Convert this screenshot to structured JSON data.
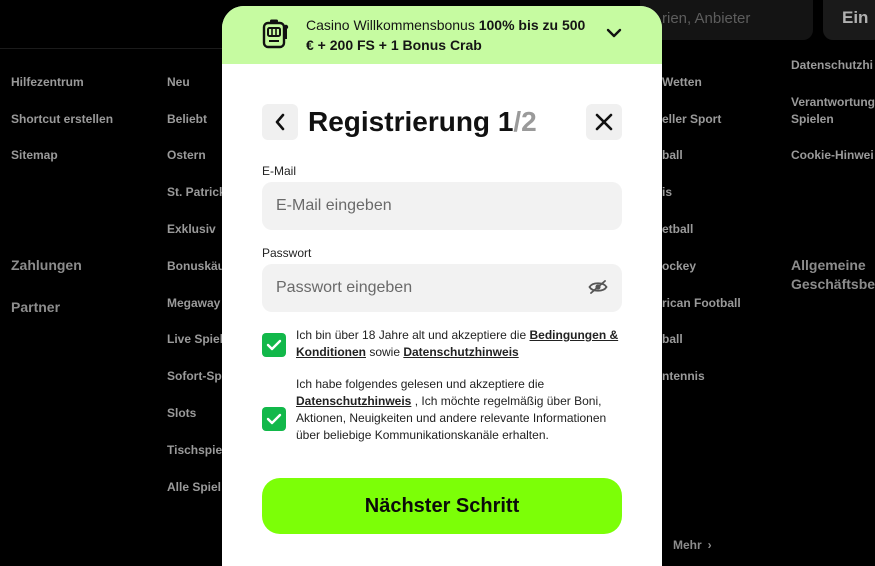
{
  "background": {
    "col1": [
      "Hilfezentrum",
      "Shortcut erstellen",
      "Sitemap"
    ],
    "col1_heads": [
      "Zahlungen",
      "Partner"
    ],
    "col2": [
      "Neu",
      "Beliebt",
      "Ostern",
      "St. Patrick",
      "Exklusiv",
      "Bonuskäu",
      "Megaway",
      "Live Spiel",
      "Sofort-Sp",
      "Slots",
      "Tischspie",
      "Alle Spiel"
    ],
    "col3": [
      "Wetten",
      "eller Sport",
      "ball",
      "is",
      "etball",
      "ockey",
      "rican Football",
      "ball",
      "ntennis"
    ],
    "col4": [
      "Datenschutzhi",
      "Verantwortung Spielen",
      "Cookie-Hinwei"
    ],
    "col4_head": "Allgemeine Geschäftsbe",
    "more": "Mehr",
    "search_placeholder": "rien, Anbieter",
    "top_button": "Ein"
  },
  "bonus": {
    "prefix": "Casino Willkommensbonus ",
    "highlight": "100% bis zu 500 € + 200 FS + 1 Bonus Crab"
  },
  "header": {
    "title": "Registrierung ",
    "step": "1",
    "total": "/2"
  },
  "form": {
    "email_label": "E-Mail",
    "email_placeholder": "E-Mail eingeben",
    "email_value": "",
    "password_label": "Passwort",
    "password_placeholder": "Passwort eingeben",
    "password_value": ""
  },
  "consent1": {
    "checked": true,
    "text_a": "Ich bin über 18 Jahre alt und akzeptiere die ",
    "link1": "Bedingungen & Konditionen",
    "text_b": " sowie ",
    "link2": "Datenschutzhinweis"
  },
  "consent2": {
    "checked": true,
    "text_a": "Ich habe folgendes gelesen und akzeptiere die ",
    "link1": "Datenschutzhinweis",
    "text_b": " , Ich möchte regelmäßig über Boni, Aktionen, Neuigkeiten und andere relevante Informationen über beliebige Kommunikationskanäle erhalten."
  },
  "next_button": "Nächster Schritt",
  "colors": {
    "bonus_bg": "#c6fba1",
    "accent": "#7cff07",
    "check": "#12b84a"
  }
}
